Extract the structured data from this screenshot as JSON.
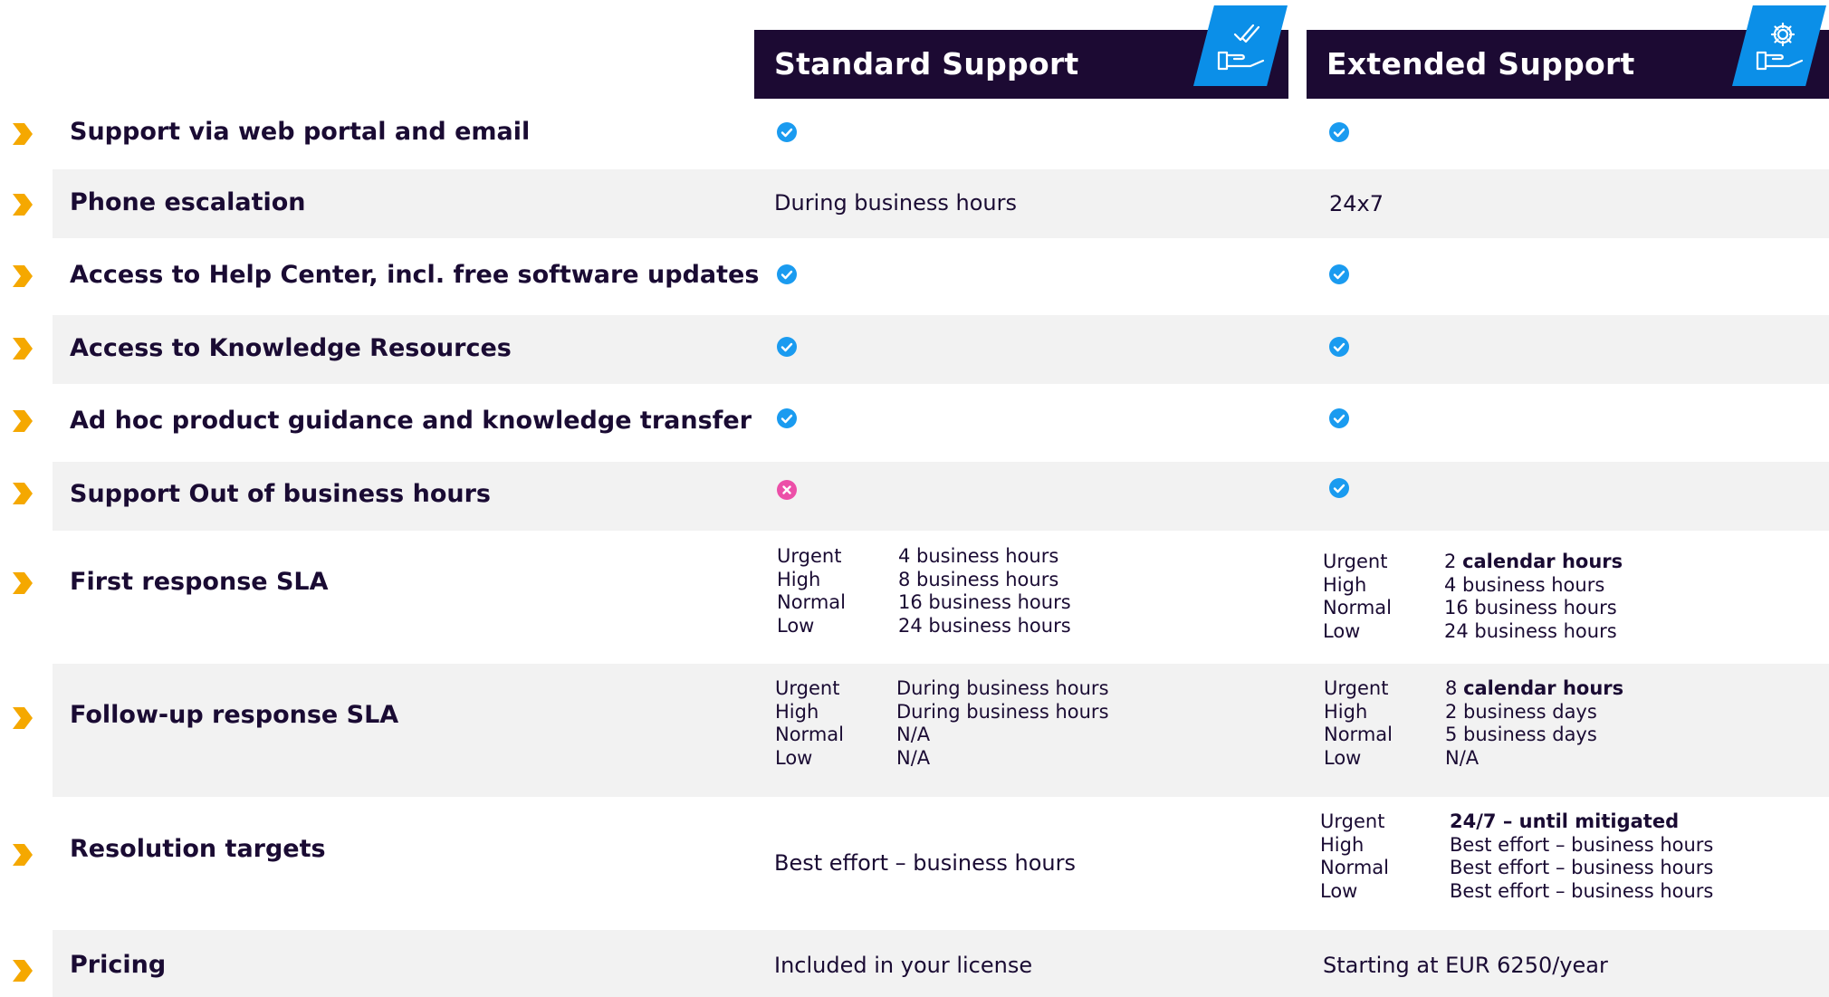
{
  "columns": {
    "standard": {
      "title": "Standard Support",
      "icon": "hand-check-icon"
    },
    "extended": {
      "title": "Extended Support",
      "icon": "hand-gear-icon"
    }
  },
  "colors": {
    "header_bg": "#1c0a33",
    "accent": "#0b8fe8",
    "chevron": "#f5a800",
    "check": "#1a9bf0",
    "cross": "#ec4fa8",
    "band": "#f2f2f2"
  },
  "rows": {
    "web_portal": {
      "label": "Support via web portal and email",
      "standard": "check",
      "extended": "check"
    },
    "phone": {
      "label": "Phone escalation",
      "standard": "During business hours",
      "extended": "24x7"
    },
    "help_center": {
      "label": "Access to Help Center, incl. free software updates",
      "standard": "check",
      "extended": "check"
    },
    "knowledge": {
      "label": "Access to Knowledge Resources",
      "standard": "check",
      "extended": "check"
    },
    "adhoc": {
      "label": "Ad hoc product guidance and knowledge transfer",
      "standard": "check",
      "extended": "check"
    },
    "out_hours": {
      "label": "Support Out of business hours",
      "standard": "cross",
      "extended": "check"
    },
    "first_response": {
      "label": "First response SLA",
      "levels": [
        "Urgent",
        "High",
        "Normal",
        "Low"
      ],
      "standard": [
        "4 business hours",
        "8 business hours",
        "16 business hours",
        "24 business hours"
      ],
      "extended_urgent_num": "2",
      "extended_urgent_unit": "calendar hours",
      "extended": [
        "4 business hours",
        "16 business hours",
        "24 business hours"
      ]
    },
    "followup": {
      "label": "Follow-up response SLA",
      "levels": [
        "Urgent",
        "High",
        "Normal",
        "Low"
      ],
      "standard": [
        "During business hours",
        "During business hours",
        "N/A",
        "N/A"
      ],
      "extended_urgent_num": "8",
      "extended_urgent_unit": "calendar hours",
      "extended": [
        "2 business days",
        "5 business days",
        "N/A"
      ]
    },
    "resolution": {
      "label": "Resolution targets",
      "standard": "Best effort – business hours",
      "levels": [
        "Urgent",
        "High",
        "Normal",
        "Low"
      ],
      "extended_urgent": "24/7 – until mitigated",
      "extended": [
        "Best effort – business hours",
        "Best effort – business hours",
        "Best effort – business hours"
      ]
    },
    "pricing": {
      "label": "Pricing",
      "standard": "Included in your license",
      "extended": "Starting at EUR 6250/year"
    }
  }
}
